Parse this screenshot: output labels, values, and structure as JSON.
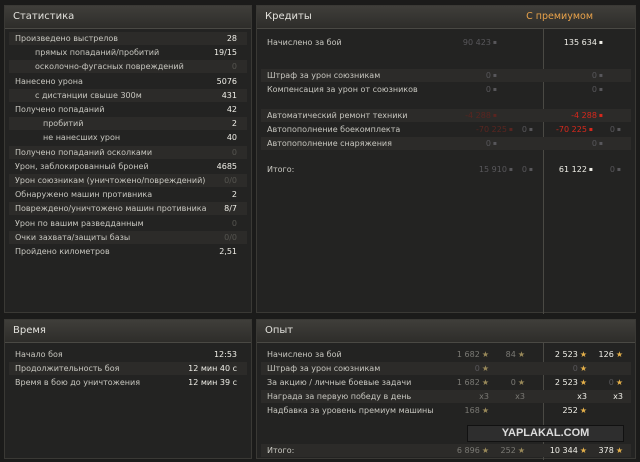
{
  "stats": {
    "title": "Статистика",
    "rows": [
      {
        "label": "Произведено выстрелов",
        "value": "28"
      },
      {
        "label": "прямых попаданий/пробитий",
        "value": "19/15"
      },
      {
        "label": "осколочно-фугасных повреждений",
        "value": "0"
      },
      {
        "label": "Нанесено урона",
        "value": "5076"
      },
      {
        "label": "с дистанции свыше 300м",
        "value": "431"
      },
      {
        "label": "Получено попаданий",
        "value": "42"
      },
      {
        "label": "пробитий",
        "value": "2"
      },
      {
        "label": "не нанесших урон",
        "value": "40"
      },
      {
        "label": "Получено попаданий осколками",
        "value": "0"
      },
      {
        "label": "Урон, заблокированный броней",
        "value": "4685"
      },
      {
        "label": "Урон союзникам (уничтожено/повреждений)",
        "value": "0/0"
      },
      {
        "label": "Обнаружено машин противника",
        "value": "2"
      },
      {
        "label": "Повреждено/уничтожено машин противника",
        "value": "8/7"
      },
      {
        "label": "Урон по вашим разведданным",
        "value": "0"
      },
      {
        "label": "Очки захвата/защиты базы",
        "value": "0/0"
      },
      {
        "label": "Пройдено километров",
        "value": "2,51"
      }
    ]
  },
  "credits": {
    "title": "Кредиты",
    "premium_label": "С премиумом",
    "rows": [
      {
        "label": "Начислено за бой",
        "base": "90 423",
        "base_extra": "",
        "prem": "135 634",
        "prem_extra": ""
      },
      {
        "label": "Штраф за урон союзникам",
        "base": "0",
        "base_extra": "",
        "prem": "0",
        "prem_extra": ""
      },
      {
        "label": "Компенсация за урон от союзников",
        "base": "0",
        "base_extra": "",
        "prem": "0",
        "prem_extra": ""
      },
      {
        "label": "Автоматический ремонт техники",
        "base": "-4 288",
        "base_extra": "",
        "prem": "-4 288",
        "prem_extra": ""
      },
      {
        "label": "Автопополнение боекомплекта",
        "base": "-70 225",
        "base_extra": "0",
        "prem": "-70 225",
        "prem_extra": "0"
      },
      {
        "label": "Автопополнение снаряжения",
        "base": "0",
        "base_extra": "",
        "prem": "0",
        "prem_extra": ""
      },
      {
        "label": "Итого:",
        "base": "15 910",
        "base_extra": "0",
        "prem": "61 122",
        "prem_extra": "0"
      }
    ]
  },
  "time": {
    "title": "Время",
    "rows": [
      {
        "label": "Начало боя",
        "value": "12:53"
      },
      {
        "label": "Продолжительность боя",
        "value": "12 мин 40 с"
      },
      {
        "label": "Время в бою до уничтожения",
        "value": "12 мин 39 с"
      }
    ]
  },
  "exp": {
    "title": "Опыт",
    "rows": [
      {
        "label": "Начислено за бой",
        "b1": "1 682",
        "b2": "84",
        "p1": "2 523",
        "p2": "126"
      },
      {
        "label": "Штраф за урон союзникам",
        "b1": "0",
        "b2": "",
        "p1": "0",
        "p2": ""
      },
      {
        "label": "За акцию / личные боевые задачи",
        "b1": "1 682",
        "b2": "0",
        "p1": "2 523",
        "p2": "0"
      },
      {
        "label": "Награда за первую победу в день",
        "b1": "x3",
        "b2": "x3",
        "p1": "x3",
        "p2": "x3"
      },
      {
        "label": "Надбавка за уровень премиум машины",
        "b1": "168",
        "b2": "",
        "p1": "252",
        "p2": ""
      },
      {
        "label": "Итого:",
        "b1": "6 896",
        "b2": "252",
        "p1": "10 344",
        "p2": "378"
      }
    ]
  },
  "watermark": "YAPLAKAL.COM",
  "icons": {
    "credit": "coin-icon",
    "xp": "star-icon"
  }
}
